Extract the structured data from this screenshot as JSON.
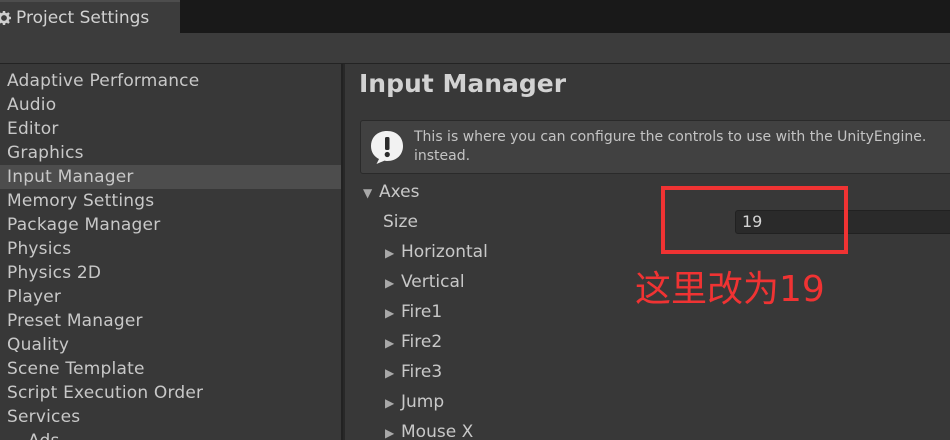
{
  "window": {
    "tab_title": "Project Settings",
    "tab_icon": "gear-icon"
  },
  "sidebar": {
    "items": [
      {
        "label": "Adaptive Performance"
      },
      {
        "label": "Audio"
      },
      {
        "label": "Editor"
      },
      {
        "label": "Graphics"
      },
      {
        "label": "Input Manager",
        "selected": true
      },
      {
        "label": "Memory Settings"
      },
      {
        "label": "Package Manager"
      },
      {
        "label": "Physics"
      },
      {
        "label": "Physics 2D"
      },
      {
        "label": "Player"
      },
      {
        "label": "Preset Manager"
      },
      {
        "label": "Quality"
      },
      {
        "label": "Scene Template"
      },
      {
        "label": "Script Execution Order"
      },
      {
        "label": "Services"
      },
      {
        "label": "Ads",
        "sub": true
      }
    ]
  },
  "main": {
    "title": "Input Manager",
    "help": {
      "icon": "info-icon",
      "line1": "This is where you can configure the controls to use with the UnityEngine.",
      "line2": "instead."
    },
    "axes": {
      "label": "Axes",
      "expanded": true,
      "size_label": "Size",
      "size_value": "19",
      "items": [
        "Horizontal",
        "Vertical",
        "Fire1",
        "Fire2",
        "Fire3",
        "Jump",
        "Mouse X"
      ]
    }
  },
  "annotation": {
    "text": "这里改为19",
    "color": "#f03333"
  }
}
